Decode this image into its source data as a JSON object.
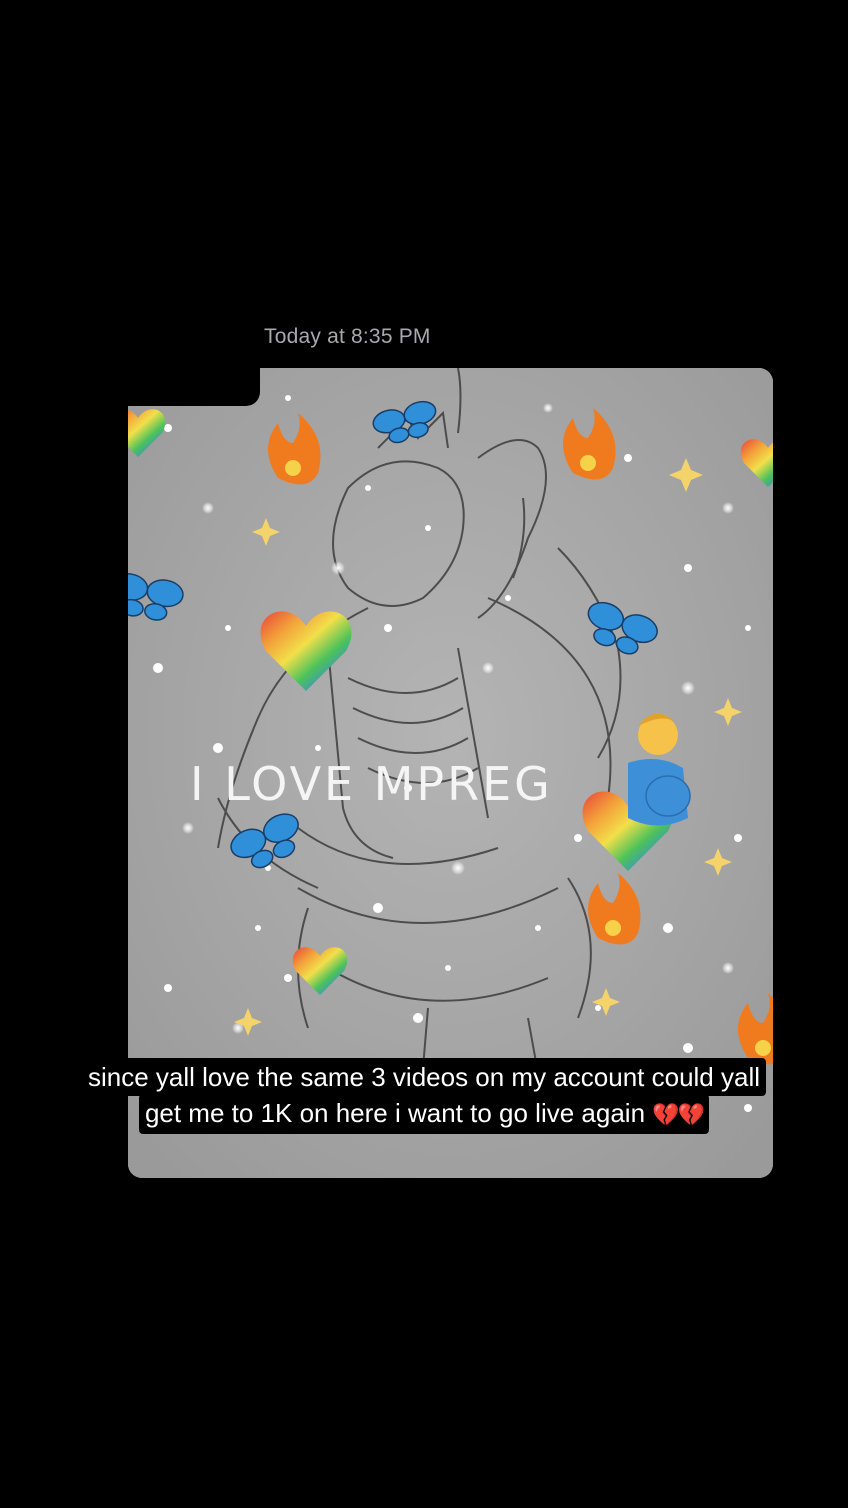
{
  "message": {
    "timestamp": "Today at 8:35 PM"
  },
  "image": {
    "overlay_text": "I LOVE MPREG",
    "stickers": {
      "fire": "🔥",
      "rainbow_heart": "❤️",
      "butterfly": "🦋",
      "pregnant_man": "🫃",
      "sparkle": "✦"
    }
  },
  "caption": {
    "line1": "since yall love the same 3 videos on my account could yall",
    "line2": "get me to 1K on here i want to go live again",
    "emoji": "💔💔"
  },
  "colors": {
    "background": "#000000",
    "timestamp": "#a8a8ad",
    "card": "#a5a5a5",
    "butterfly": "#2f8fd8",
    "fire": "#f07a1e"
  }
}
